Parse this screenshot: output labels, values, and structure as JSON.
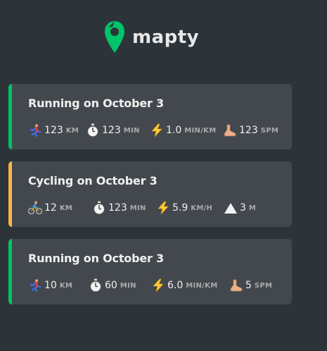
{
  "logo": {
    "text": "mapty",
    "icon": "map-pin-icon"
  },
  "workouts": [
    {
      "type": "running",
      "title": "Running on October 3",
      "details": [
        {
          "icon": "runner-icon",
          "value": "123",
          "unit": "km"
        },
        {
          "icon": "stopwatch-icon",
          "value": "123",
          "unit": "min"
        },
        {
          "icon": "lightning-icon",
          "value": "1.0",
          "unit": "min/km"
        },
        {
          "icon": "footprint-icon",
          "value": "123",
          "unit": "spm"
        }
      ]
    },
    {
      "type": "cycling",
      "title": "Cycling on October 3",
      "details": [
        {
          "icon": "cyclist-icon",
          "value": "12",
          "unit": "km"
        },
        {
          "icon": "stopwatch-icon",
          "value": "123",
          "unit": "min"
        },
        {
          "icon": "lightning-icon",
          "value": "5.9",
          "unit": "km/h"
        },
        {
          "icon": "mountain-icon",
          "value": "3",
          "unit": "m"
        }
      ]
    },
    {
      "type": "running",
      "title": "Running on October 3",
      "details": [
        {
          "icon": "runner-icon",
          "value": "10",
          "unit": "km"
        },
        {
          "icon": "stopwatch-icon",
          "value": "60",
          "unit": "min"
        },
        {
          "icon": "lightning-icon",
          "value": "6.0",
          "unit": "min/km"
        },
        {
          "icon": "footprint-icon",
          "value": "5",
          "unit": "spm"
        }
      ]
    }
  ],
  "colors": {
    "running": "#00c46a",
    "cycling": "#ffb545",
    "background": "#2d3439",
    "card": "#42484d"
  }
}
